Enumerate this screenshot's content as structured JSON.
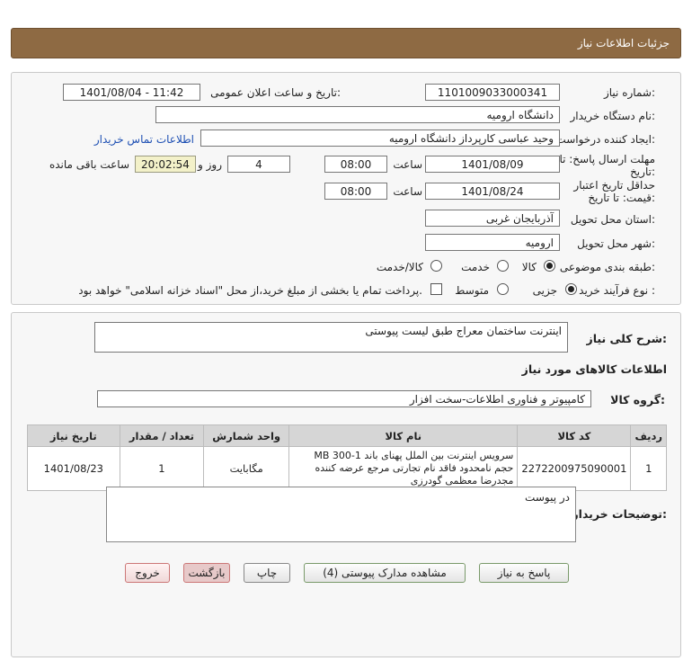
{
  "header": {
    "title": "جزئیات اطلاعات نیاز"
  },
  "form": {
    "need_number": {
      "label": "شماره نیاز:",
      "value": "1101009033000341"
    },
    "announce_datetime": {
      "label": "تاریخ و ساعت اعلان عمومی:",
      "value": "1401/08/04 - 11:42"
    },
    "buyer_org": {
      "label": "نام دستگاه خریدار:",
      "value": "دانشگاه ارومیه"
    },
    "requester": {
      "label": "ایجاد کننده درخواست:",
      "value": "وحید عباسی کارپرداز دانشگاه ارومیه",
      "contact_link": "اطلاعات تماس خریدار"
    },
    "reply_deadline": {
      "label_line1": "مهلت ارسال پاسخ: تا",
      "label_line2": "تاریخ:",
      "date": "1401/08/09",
      "time_label": "ساعت",
      "time": "08:00",
      "days": "4",
      "days_label": "روز و",
      "remaining": "20:02:54",
      "remaining_label": "ساعت باقی مانده"
    },
    "price_validity": {
      "label_line1": "حداقل تاریخ اعتبار",
      "label_line2": "قیمت: تا تاریخ:",
      "date": "1401/08/24",
      "time_label": "ساعت",
      "time": "08:00"
    },
    "province": {
      "label": "استان محل تحویل:",
      "value": "آذربایجان غربی"
    },
    "city": {
      "label": "شهر محل تحویل:",
      "value": "ارومیه"
    },
    "category": {
      "label": "طبقه بندی موضوعی:",
      "options": [
        "کالا",
        "خدمت",
        "کالا/خدمت"
      ],
      "selected": "کالا"
    },
    "process_type": {
      "label": "نوع فرآیند خرید :",
      "options": [
        "جزیی",
        "متوسط"
      ],
      "selected": "جزیی",
      "payment_note": "پرداخت تمام یا بخشی از مبلغ خرید،از محل \"اسناد خزانه اسلامی\" خواهد بود."
    }
  },
  "details": {
    "summary_label": "شرح کلی نیاز:",
    "summary_value": "اینترنت ساختمان معراج طبق لیست پیوستی",
    "goods_info_title": "اطلاعات کالاهای مورد نیاز",
    "goods_group_label": "گروه کالا:",
    "goods_group_value": "کامپیوتر و فناوری اطلاعات-سخت افزار",
    "table": {
      "headers": [
        "ردیف",
        "کد کالا",
        "نام کالا",
        "واحد شمارش",
        "تعداد / مقدار",
        "تاریخ نیاز"
      ],
      "rows": [
        [
          "1",
          "2272200975090001",
          "سرویس اینترنت بین الملل پهنای باند MB 300-1 حجم نامحدود فاقد نام تجارتی مرجع عرضه کننده مجدرضا معظمی گودرزی",
          "مگابایت",
          "1",
          "1401/08/23"
        ]
      ]
    },
    "buyer_notes_label": "توضیحات خریدار:",
    "buyer_notes_value": "در پیوست"
  },
  "buttons": {
    "reply": "پاسخ به نیاز",
    "attachments": "مشاهده مدارک پیوستی (4)",
    "print": "چاپ",
    "back": "بازگشت",
    "exit": "خروج"
  }
}
